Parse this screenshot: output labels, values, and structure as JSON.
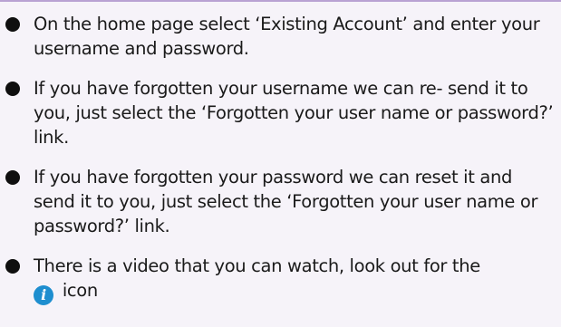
{
  "instructions": {
    "items": [
      {
        "text": "On the home page select ‘Existing Account’ and enter your username and password."
      },
      {
        "text": "If you have forgotten your username we can re- send it to you, just select the ‘Forgotten your user name or password?’ link."
      },
      {
        "text": "If you have forgotten your password we can reset it and send it to you, just select the ‘Forgotten your user name or password?’ link."
      },
      {
        "text": "There is a video that you can watch, look out for the",
        "icon": "info-icon",
        "icon_glyph": "i",
        "suffix": "icon"
      }
    ]
  },
  "colors": {
    "background": "#f6f3f9",
    "border": "#b9a2d3",
    "bullet": "#0f0f0f",
    "info_icon": "#1e8ecf"
  }
}
